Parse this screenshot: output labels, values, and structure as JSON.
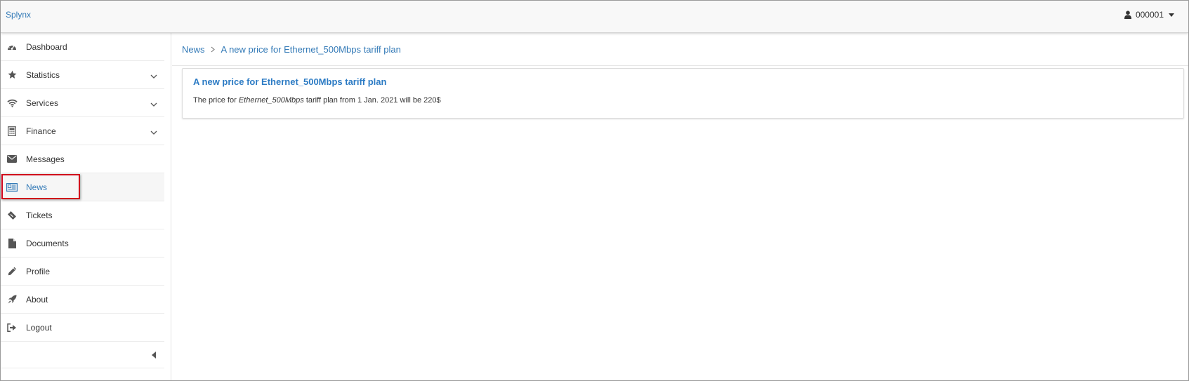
{
  "app": {
    "brand": "Splynx"
  },
  "user_menu": {
    "username": "000001",
    "icon": "user-icon"
  },
  "sidebar": {
    "items": [
      {
        "label": "Dashboard",
        "icon": "dashboard-icon",
        "has_submenu": false
      },
      {
        "label": "Statistics",
        "icon": "star-icon",
        "has_submenu": true
      },
      {
        "label": "Services",
        "icon": "wifi-icon",
        "has_submenu": true
      },
      {
        "label": "Finance",
        "icon": "calculator-icon",
        "has_submenu": true
      },
      {
        "label": "Messages",
        "icon": "envelope-icon",
        "has_submenu": false
      },
      {
        "label": "News",
        "icon": "newspaper-icon",
        "has_submenu": false,
        "active": true,
        "highlighted": true
      },
      {
        "label": "Tickets",
        "icon": "ticket-icon",
        "has_submenu": false
      },
      {
        "label": "Documents",
        "icon": "document-icon",
        "has_submenu": false
      },
      {
        "label": "Profile",
        "icon": "pencil-icon",
        "has_submenu": false
      },
      {
        "label": "About",
        "icon": "rocket-icon",
        "has_submenu": false
      },
      {
        "label": "Logout",
        "icon": "sign-out-icon",
        "has_submenu": false
      }
    ],
    "collapse_icon": "caret-left-icon"
  },
  "breadcrumb": {
    "root": "News",
    "current": "A new price for Ethernet_500Mbps tariff plan"
  },
  "news": {
    "title": "A new price for Ethernet_500Mbps tariff plan",
    "body_prefix": "The price for ",
    "body_emphasis": "Ethernet_500Mbps",
    "body_suffix": " tariff plan from 1 Jan. 2021 will be 220$"
  },
  "colors": {
    "link": "#337ab7",
    "highlight": "#d0021b",
    "navbar_bg": "#f8f8f8"
  }
}
